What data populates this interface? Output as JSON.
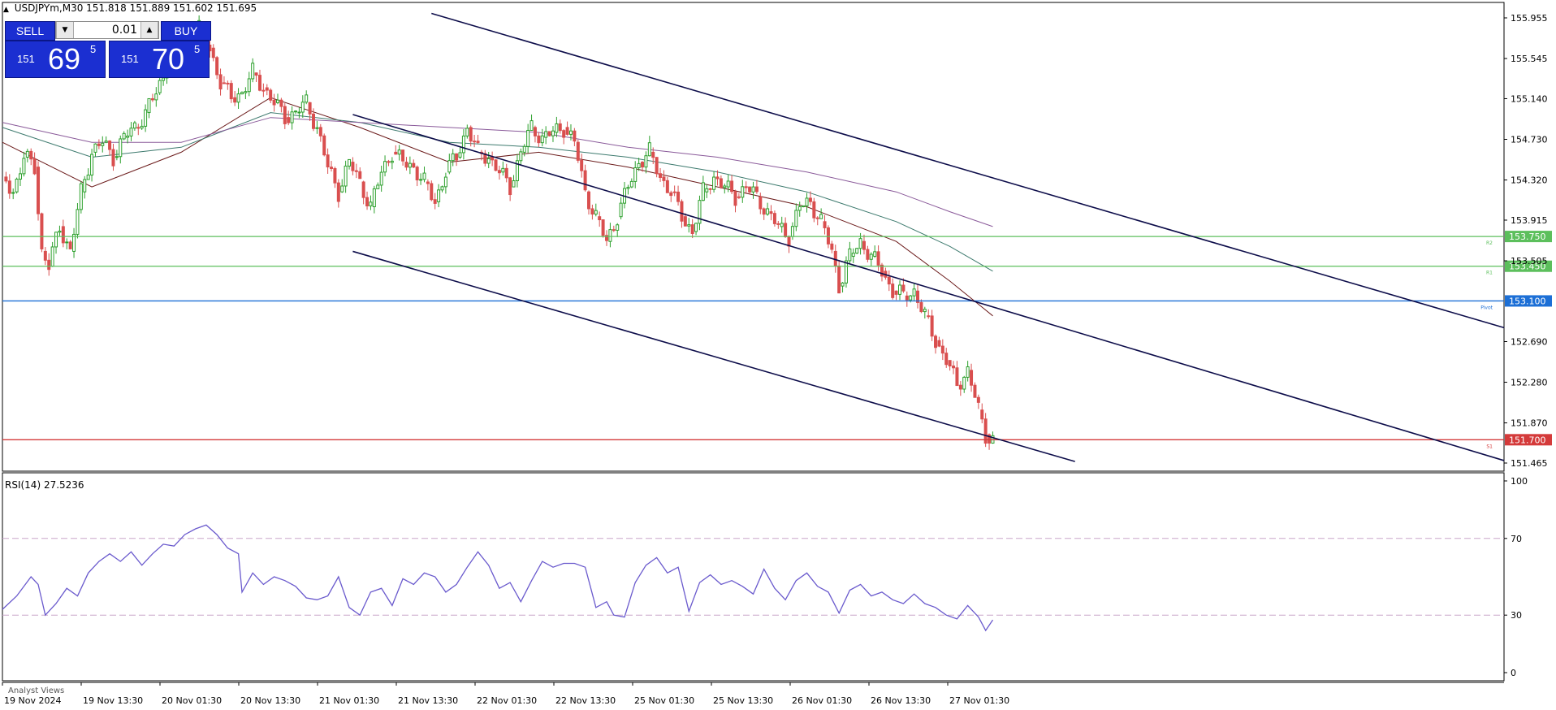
{
  "header": {
    "symbol_line": "USDJPYm,M30  151.818 151.889 151.602 151.695"
  },
  "trade_panel": {
    "sell_label": "SELL",
    "buy_label": "BUY",
    "lot_value": "0.01",
    "sell_quote": {
      "big": "151",
      "pips": "69",
      "fraction": "5"
    },
    "buy_quote": {
      "big": "151",
      "pips": "70",
      "fraction": "5"
    }
  },
  "chart_data": [
    {
      "type": "candlestick",
      "title": "USDJPYm,M30",
      "ohlc_current": {
        "open": 151.818,
        "high": 151.889,
        "low": 151.602,
        "close": 151.695
      },
      "ylim": [
        151.465,
        155.955
      ],
      "y_ticks": [
        "155.955",
        "155.545",
        "155.140",
        "154.730",
        "154.320",
        "153.915",
        "153.505",
        "152.690",
        "152.280",
        "151.870",
        "151.465"
      ],
      "x_ticks": [
        "19 Nov 2024",
        "19 Nov 13:30",
        "20 Nov 01:30",
        "20 Nov 13:30",
        "21 Nov 01:30",
        "21 Nov 13:30",
        "22 Nov 01:30",
        "22 Nov 13:30",
        "25 Nov 01:30",
        "25 Nov 13:30",
        "26 Nov 01:30",
        "26 Nov 13:30",
        "27 Nov 01:30"
      ],
      "close_path": [
        {
          "x": 0,
          "close": 154.35
        },
        {
          "x": 3,
          "close": 154.2
        },
        {
          "x": 6,
          "close": 154.55
        },
        {
          "x": 9,
          "close": 154.45
        },
        {
          "x": 11,
          "close": 153.6
        },
        {
          "x": 13,
          "close": 153.45
        },
        {
          "x": 16,
          "close": 153.85
        },
        {
          "x": 19,
          "close": 153.6
        },
        {
          "x": 22,
          "close": 154.2
        },
        {
          "x": 25,
          "close": 154.6
        },
        {
          "x": 28,
          "close": 154.7
        },
        {
          "x": 31,
          "close": 154.55
        },
        {
          "x": 34,
          "close": 154.75
        },
        {
          "x": 37,
          "close": 154.85
        },
        {
          "x": 40,
          "close": 155.0
        },
        {
          "x": 43,
          "close": 155.2
        },
        {
          "x": 46,
          "close": 155.45
        },
        {
          "x": 49,
          "close": 155.7
        },
        {
          "x": 52,
          "close": 155.8
        },
        {
          "x": 55,
          "close": 155.85
        },
        {
          "x": 58,
          "close": 155.65
        },
        {
          "x": 61,
          "close": 155.3
        },
        {
          "x": 64,
          "close": 155.15
        },
        {
          "x": 67,
          "close": 155.2
        },
        {
          "x": 70,
          "close": 155.4
        },
        {
          "x": 73,
          "close": 155.25
        },
        {
          "x": 76,
          "close": 155.1
        },
        {
          "x": 79,
          "close": 154.95
        },
        {
          "x": 82,
          "close": 155.0
        },
        {
          "x": 85,
          "close": 155.1
        },
        {
          "x": 88,
          "close": 154.85
        },
        {
          "x": 91,
          "close": 154.45
        },
        {
          "x": 94,
          "close": 154.2
        },
        {
          "x": 97,
          "close": 154.5
        },
        {
          "x": 100,
          "close": 154.3
        },
        {
          "x": 103,
          "close": 154.05
        },
        {
          "x": 106,
          "close": 154.4
        },
        {
          "x": 109,
          "close": 154.6
        },
        {
          "x": 112,
          "close": 154.5
        },
        {
          "x": 115,
          "close": 154.45
        },
        {
          "x": 118,
          "close": 154.3
        },
        {
          "x": 121,
          "close": 154.1
        },
        {
          "x": 124,
          "close": 154.4
        },
        {
          "x": 127,
          "close": 154.55
        },
        {
          "x": 130,
          "close": 154.85
        },
        {
          "x": 133,
          "close": 154.6
        },
        {
          "x": 136,
          "close": 154.55
        },
        {
          "x": 139,
          "close": 154.4
        },
        {
          "x": 142,
          "close": 154.25
        },
        {
          "x": 145,
          "close": 154.6
        },
        {
          "x": 148,
          "close": 154.85
        },
        {
          "x": 151,
          "close": 154.75
        },
        {
          "x": 154,
          "close": 154.8
        },
        {
          "x": 157,
          "close": 154.85
        },
        {
          "x": 160,
          "close": 154.7
        },
        {
          "x": 163,
          "close": 154.2
        },
        {
          "x": 166,
          "close": 153.95
        },
        {
          "x": 169,
          "close": 153.7
        },
        {
          "x": 172,
          "close": 153.95
        },
        {
          "x": 175,
          "close": 154.25
        },
        {
          "x": 178,
          "close": 154.5
        },
        {
          "x": 181,
          "close": 154.6
        },
        {
          "x": 184,
          "close": 154.35
        },
        {
          "x": 187,
          "close": 154.2
        },
        {
          "x": 190,
          "close": 153.95
        },
        {
          "x": 193,
          "close": 153.8
        },
        {
          "x": 196,
          "close": 154.2
        },
        {
          "x": 199,
          "close": 154.35
        },
        {
          "x": 202,
          "close": 154.25
        },
        {
          "x": 205,
          "close": 154.15
        },
        {
          "x": 208,
          "close": 154.25
        },
        {
          "x": 211,
          "close": 154.15
        },
        {
          "x": 214,
          "close": 154.0
        },
        {
          "x": 217,
          "close": 153.85
        },
        {
          "x": 220,
          "close": 153.75
        },
        {
          "x": 223,
          "close": 154.05
        },
        {
          "x": 226,
          "close": 154.1
        },
        {
          "x": 229,
          "close": 153.9
        },
        {
          "x": 232,
          "close": 153.6
        },
        {
          "x": 234,
          "close": 153.25
        },
        {
          "x": 237,
          "close": 153.55
        },
        {
          "x": 240,
          "close": 153.7
        },
        {
          "x": 243,
          "close": 153.55
        },
        {
          "x": 246,
          "close": 153.4
        },
        {
          "x": 249,
          "close": 153.2
        },
        {
          "x": 252,
          "close": 153.15
        },
        {
          "x": 255,
          "close": 153.2
        },
        {
          "x": 258,
          "close": 152.95
        },
        {
          "x": 261,
          "close": 152.7
        },
        {
          "x": 264,
          "close": 152.5
        },
        {
          "x": 267,
          "close": 152.25
        },
        {
          "x": 270,
          "close": 152.4
        },
        {
          "x": 273,
          "close": 152.0
        },
        {
          "x": 275,
          "close": 151.75
        },
        {
          "x": 277,
          "close": 151.7
        }
      ],
      "moving_averages": [
        {
          "color": "#6b1a1a",
          "values": [
            {
              "x": 0,
              "y": 154.7
            },
            {
              "x": 25,
              "y": 154.25
            },
            {
              "x": 50,
              "y": 154.6
            },
            {
              "x": 75,
              "y": 155.15
            },
            {
              "x": 100,
              "y": 154.85
            },
            {
              "x": 125,
              "y": 154.5
            },
            {
              "x": 150,
              "y": 154.6
            },
            {
              "x": 175,
              "y": 154.45
            },
            {
              "x": 200,
              "y": 154.25
            },
            {
              "x": 225,
              "y": 154.05
            },
            {
              "x": 250,
              "y": 153.7
            },
            {
              "x": 265,
              "y": 153.3
            },
            {
              "x": 277,
              "y": 152.95
            }
          ]
        },
        {
          "color": "#3d7a6e",
          "values": [
            {
              "x": 0,
              "y": 154.85
            },
            {
              "x": 25,
              "y": 154.55
            },
            {
              "x": 50,
              "y": 154.65
            },
            {
              "x": 75,
              "y": 155.0
            },
            {
              "x": 100,
              "y": 154.9
            },
            {
              "x": 125,
              "y": 154.7
            },
            {
              "x": 150,
              "y": 154.65
            },
            {
              "x": 175,
              "y": 154.55
            },
            {
              "x": 200,
              "y": 154.4
            },
            {
              "x": 225,
              "y": 154.2
            },
            {
              "x": 250,
              "y": 153.9
            },
            {
              "x": 265,
              "y": 153.65
            },
            {
              "x": 277,
              "y": 153.4
            }
          ]
        },
        {
          "color": "#8a5a9a",
          "values": [
            {
              "x": 0,
              "y": 154.9
            },
            {
              "x": 25,
              "y": 154.7
            },
            {
              "x": 50,
              "y": 154.7
            },
            {
              "x": 75,
              "y": 154.95
            },
            {
              "x": 100,
              "y": 154.9
            },
            {
              "x": 125,
              "y": 154.85
            },
            {
              "x": 150,
              "y": 154.8
            },
            {
              "x": 175,
              "y": 154.65
            },
            {
              "x": 200,
              "y": 154.55
            },
            {
              "x": 225,
              "y": 154.4
            },
            {
              "x": 250,
              "y": 154.2
            },
            {
              "x": 265,
              "y": 154.0
            },
            {
              "x": 277,
              "y": 153.85
            }
          ]
        }
      ],
      "horizontal_levels": [
        {
          "price": "153.750",
          "value": 153.75,
          "label": "R2",
          "color": "#5cbf5c"
        },
        {
          "price": "153.450",
          "value": 153.45,
          "label": "R1",
          "color": "#5cbf5c"
        },
        {
          "price": "153.100",
          "value": 153.1,
          "label": "Pivot",
          "color": "#1c6fd6"
        },
        {
          "price": "151.700",
          "value": 151.7,
          "label": "S1",
          "color": "#d43a3a"
        }
      ],
      "trend_lines": [
        {
          "x1": 120,
          "y1": 156.0,
          "x2": 420,
          "y2": 152.83
        },
        {
          "x1": 98,
          "y1": 154.98,
          "x2": 420,
          "y2": 151.49
        },
        {
          "x1": 98,
          "y1": 153.6,
          "x2": 300,
          "y2": 151.48
        }
      ],
      "x_domain": [
        0,
        420
      ]
    },
    {
      "type": "line",
      "title": "RSI(14) 27.5236",
      "ylim": [
        0,
        100
      ],
      "y_ticks": [
        "100",
        "70",
        "30",
        "0"
      ],
      "reference_levels": [
        70,
        30
      ],
      "values": [
        {
          "x": 0,
          "y": 33
        },
        {
          "x": 4,
          "y": 40
        },
        {
          "x": 8,
          "y": 50
        },
        {
          "x": 10,
          "y": 46
        },
        {
          "x": 12,
          "y": 30
        },
        {
          "x": 15,
          "y": 36
        },
        {
          "x": 18,
          "y": 44
        },
        {
          "x": 21,
          "y": 40
        },
        {
          "x": 24,
          "y": 52
        },
        {
          "x": 27,
          "y": 58
        },
        {
          "x": 30,
          "y": 62
        },
        {
          "x": 33,
          "y": 58
        },
        {
          "x": 36,
          "y": 63
        },
        {
          "x": 39,
          "y": 56
        },
        {
          "x": 42,
          "y": 62
        },
        {
          "x": 45,
          "y": 67
        },
        {
          "x": 48,
          "y": 66
        },
        {
          "x": 51,
          "y": 72
        },
        {
          "x": 54,
          "y": 75
        },
        {
          "x": 57,
          "y": 77
        },
        {
          "x": 60,
          "y": 72
        },
        {
          "x": 63,
          "y": 65
        },
        {
          "x": 66,
          "y": 62
        },
        {
          "x": 67,
          "y": 42
        },
        {
          "x": 70,
          "y": 52
        },
        {
          "x": 73,
          "y": 46
        },
        {
          "x": 76,
          "y": 50
        },
        {
          "x": 79,
          "y": 48
        },
        {
          "x": 82,
          "y": 45
        },
        {
          "x": 85,
          "y": 39
        },
        {
          "x": 88,
          "y": 38
        },
        {
          "x": 91,
          "y": 40
        },
        {
          "x": 94,
          "y": 50
        },
        {
          "x": 97,
          "y": 34
        },
        {
          "x": 100,
          "y": 30
        },
        {
          "x": 103,
          "y": 42
        },
        {
          "x": 106,
          "y": 44
        },
        {
          "x": 109,
          "y": 35
        },
        {
          "x": 112,
          "y": 49
        },
        {
          "x": 115,
          "y": 46
        },
        {
          "x": 118,
          "y": 52
        },
        {
          "x": 121,
          "y": 50
        },
        {
          "x": 124,
          "y": 42
        },
        {
          "x": 127,
          "y": 46
        },
        {
          "x": 130,
          "y": 55
        },
        {
          "x": 133,
          "y": 63
        },
        {
          "x": 136,
          "y": 56
        },
        {
          "x": 139,
          "y": 44
        },
        {
          "x": 142,
          "y": 47
        },
        {
          "x": 145,
          "y": 37
        },
        {
          "x": 148,
          "y": 48
        },
        {
          "x": 151,
          "y": 58
        },
        {
          "x": 154,
          "y": 55
        },
        {
          "x": 157,
          "y": 57
        },
        {
          "x": 160,
          "y": 57
        },
        {
          "x": 163,
          "y": 55
        },
        {
          "x": 166,
          "y": 34
        },
        {
          "x": 169,
          "y": 37
        },
        {
          "x": 171,
          "y": 30
        },
        {
          "x": 174,
          "y": 29
        },
        {
          "x": 177,
          "y": 47
        },
        {
          "x": 180,
          "y": 56
        },
        {
          "x": 183,
          "y": 60
        },
        {
          "x": 186,
          "y": 52
        },
        {
          "x": 189,
          "y": 55
        },
        {
          "x": 192,
          "y": 32
        },
        {
          "x": 195,
          "y": 47
        },
        {
          "x": 198,
          "y": 51
        },
        {
          "x": 201,
          "y": 46
        },
        {
          "x": 204,
          "y": 48
        },
        {
          "x": 207,
          "y": 45
        },
        {
          "x": 210,
          "y": 41
        },
        {
          "x": 213,
          "y": 54
        },
        {
          "x": 216,
          "y": 44
        },
        {
          "x": 219,
          "y": 38
        },
        {
          "x": 222,
          "y": 48
        },
        {
          "x": 225,
          "y": 52
        },
        {
          "x": 228,
          "y": 45
        },
        {
          "x": 231,
          "y": 42
        },
        {
          "x": 234,
          "y": 31
        },
        {
          "x": 237,
          "y": 43
        },
        {
          "x": 240,
          "y": 46
        },
        {
          "x": 243,
          "y": 40
        },
        {
          "x": 246,
          "y": 42
        },
        {
          "x": 249,
          "y": 38
        },
        {
          "x": 252,
          "y": 36
        },
        {
          "x": 255,
          "y": 41
        },
        {
          "x": 258,
          "y": 36
        },
        {
          "x": 261,
          "y": 34
        },
        {
          "x": 264,
          "y": 30
        },
        {
          "x": 267,
          "y": 28
        },
        {
          "x": 270,
          "y": 35
        },
        {
          "x": 273,
          "y": 29
        },
        {
          "x": 275,
          "y": 22
        },
        {
          "x": 277,
          "y": 27.5
        }
      ],
      "x_domain": [
        0,
        420
      ]
    }
  ],
  "footer": {
    "analyst_views": "Analyst Views"
  },
  "colors": {
    "bull": "#2ca02c",
    "bear": "#d94f4f",
    "trend": "#0d0d4a",
    "rsi": "#6a5acd",
    "grid_axis": "#000000"
  }
}
